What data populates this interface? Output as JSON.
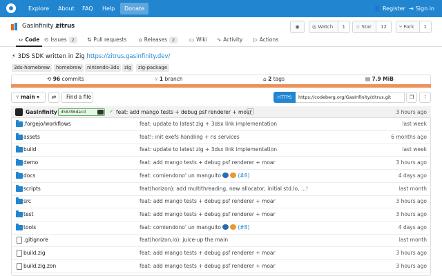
{
  "navbar": {
    "links": [
      {
        "label": "Explore"
      },
      {
        "label": "About"
      },
      {
        "label": "FAQ"
      },
      {
        "label": "Help"
      },
      {
        "label": "Donate"
      }
    ],
    "register_label": "Register",
    "signin_label": "Sign in"
  },
  "repo": {
    "owner": "GasInfinity",
    "separator": "/",
    "name": "zitrus",
    "rss_label": "RSS",
    "watch_label": "Watch",
    "watch_count": "1",
    "star_label": "Star",
    "star_count": "12",
    "fork_label": "Fork",
    "fork_count": "1"
  },
  "tabs": [
    {
      "label": "Code",
      "icon": "code-icon"
    },
    {
      "label": "Issues",
      "icon": "issue-icon",
      "badge": "2"
    },
    {
      "label": "Pull requests",
      "icon": "pull-request-icon"
    },
    {
      "label": "Releases",
      "icon": "tag-icon",
      "badge": "2"
    },
    {
      "label": "Wiki",
      "icon": "book-icon"
    },
    {
      "label": "Activity",
      "icon": "pulse-icon"
    },
    {
      "label": "Actions",
      "icon": "play-icon"
    }
  ],
  "description": {
    "text": "⚡ 3DS SDK written in Zig ",
    "link": "https://zitrus.gasinfinity.dev/"
  },
  "topics": [
    "3ds-homebrew",
    "homebrew",
    "nintendo-3ds",
    "zig",
    "zig-package"
  ],
  "stats": {
    "commits_count": "96",
    "commits_label": "commits",
    "branch_count": "1",
    "branch_label": "branch",
    "tags_count": "2",
    "tags_label": "tags",
    "size_value": "7.9",
    "size_unit": "MiB"
  },
  "lang_color": "#ec915c",
  "branch_row": {
    "branch": "main",
    "find_file_label": "Find a file",
    "https_label": "HTTPS",
    "clone_url": "https://codeberg.org/GasInfinity/zitrus.git"
  },
  "latest_commit": {
    "author": "GasInfinity",
    "sha": "d58396dacd",
    "message": "feat: add mango tests + debug psf renderer + moar",
    "time": "3 hours ago"
  },
  "files": [
    {
      "type": "dir",
      "icon": "folder-icon",
      "name": ".forgejo/workflows",
      "message": "feat: update to latest zig + 3dsx link implementation",
      "time": "last week"
    },
    {
      "type": "dir",
      "icon": "folder-icon",
      "name": "assets",
      "message": "feat!: init exefs handling + ns services",
      "time": "6 months ago"
    },
    {
      "type": "dir",
      "icon": "folder-icon",
      "name": "build",
      "message": "feat: update to latest zig + 3dsx link implementation",
      "time": "last week"
    },
    {
      "type": "dir",
      "icon": "folder-icon",
      "name": "demo",
      "message": "feat: add mango tests + debug psf renderer + moar",
      "time": "3 hours ago"
    },
    {
      "type": "dir",
      "icon": "folder-icon",
      "name": "docs",
      "message": "feat: comiendono' un manguito",
      "issue": "(#8)",
      "time": "4 days ago"
    },
    {
      "type": "dir",
      "icon": "folder-icon",
      "name": "scripts",
      "message": "feat(horizon): add multithreading, new allocator, initial std.Io, ...!",
      "time": "last month"
    },
    {
      "type": "dir",
      "icon": "folder-icon",
      "name": "src",
      "message": "feat: add mango tests + debug psf renderer + moar",
      "time": "3 hours ago"
    },
    {
      "type": "dir",
      "icon": "folder-icon",
      "name": "test",
      "message": "feat: add mango tests + debug psf renderer + moar",
      "time": "3 hours ago"
    },
    {
      "type": "dir",
      "icon": "folder-icon",
      "name": "tools",
      "message": "feat: comiendono' un manguito",
      "issue": "(#8)",
      "time": "4 days ago"
    },
    {
      "type": "file",
      "icon": "file-icon",
      "name": ".gitignore",
      "message": "feat(horizon.io): juice-up the main",
      "time": "last month"
    },
    {
      "type": "file",
      "icon": "file-icon",
      "name": "build.zig",
      "message": "feat: add mango tests + debug psf renderer + moar",
      "time": "3 hours ago"
    },
    {
      "type": "file",
      "icon": "file-icon",
      "name": "build.zig.zon",
      "message": "feat: add mango tests + debug psf renderer + moar",
      "time": "3 hours ago"
    }
  ]
}
